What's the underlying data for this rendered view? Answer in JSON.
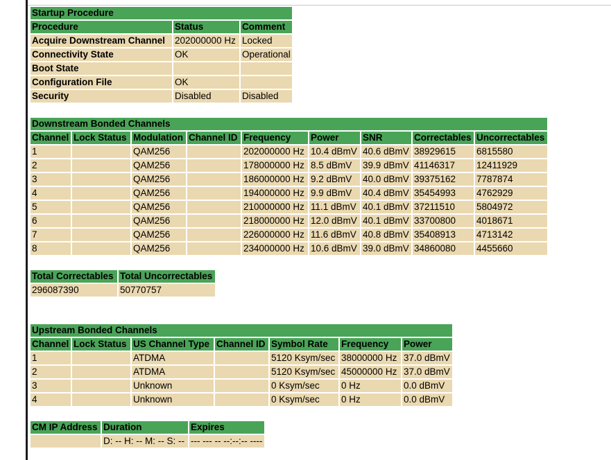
{
  "startup": {
    "title": "Startup Procedure",
    "headers": [
      "Procedure",
      "Status",
      "Comment"
    ],
    "rows": [
      [
        "Acquire Downstream Channel",
        "202000000 Hz",
        "Locked"
      ],
      [
        "Connectivity State",
        "OK",
        "Operational"
      ],
      [
        "Boot State",
        "",
        ""
      ],
      [
        "Configuration File",
        "OK",
        ""
      ],
      [
        "Security",
        "Disabled",
        "Disabled"
      ]
    ]
  },
  "downstream": {
    "title": "Downstream Bonded Channels",
    "headers": [
      "Channel",
      "Lock Status",
      "Modulation",
      "Channel ID",
      "Frequency",
      "Power",
      "SNR",
      "Correctables",
      "Uncorrectables"
    ],
    "rows": [
      [
        "1",
        "",
        "QAM256",
        "",
        "202000000 Hz",
        "10.4 dBmV",
        "40.6 dBmV",
        "38929615",
        "6815580"
      ],
      [
        "2",
        "",
        "QAM256",
        "",
        "178000000 Hz",
        "8.5 dBmV",
        "39.9 dBmV",
        "41146317",
        "12411929"
      ],
      [
        "3",
        "",
        "QAM256",
        "",
        "186000000 Hz",
        "9.2 dBmV",
        "40.0 dBmV",
        "39375162",
        "7787874"
      ],
      [
        "4",
        "",
        "QAM256",
        "",
        "194000000 Hz",
        "9.9 dBmV",
        "40.4 dBmV",
        "35454993",
        "4762929"
      ],
      [
        "5",
        "",
        "QAM256",
        "",
        "210000000 Hz",
        "11.1 dBmV",
        "40.1 dBmV",
        "37211510",
        "5804972"
      ],
      [
        "6",
        "",
        "QAM256",
        "",
        "218000000 Hz",
        "12.0 dBmV",
        "40.1 dBmV",
        "33700800",
        "4018671"
      ],
      [
        "7",
        "",
        "QAM256",
        "",
        "226000000 Hz",
        "11.6 dBmV",
        "40.8 dBmV",
        "35408913",
        "4713142"
      ],
      [
        "8",
        "",
        "QAM256",
        "",
        "234000000 Hz",
        "10.6 dBmV",
        "39.0 dBmV",
        "34860080",
        "4455660"
      ]
    ]
  },
  "totals": {
    "headers": [
      "Total Correctables",
      "Total Uncorrectables"
    ],
    "values": [
      "296087390",
      "50770757"
    ]
  },
  "upstream": {
    "title": "Upstream Bonded Channels",
    "headers": [
      "Channel",
      "Lock Status",
      "US Channel Type",
      "Channel ID",
      "Symbol Rate",
      "Frequency",
      "Power"
    ],
    "rows": [
      [
        "1",
        "",
        "ATDMA",
        "",
        "5120 Ksym/sec",
        "38000000 Hz",
        "37.0 dBmV"
      ],
      [
        "2",
        "",
        "ATDMA",
        "",
        "5120 Ksym/sec",
        "45000000 Hz",
        "37.0 dBmV"
      ],
      [
        "3",
        "",
        "Unknown",
        "",
        "0 Ksym/sec",
        "0 Hz",
        "0.0 dBmV"
      ],
      [
        "4",
        "",
        "Unknown",
        "",
        "0 Ksym/sec",
        "0 Hz",
        "0.0 dBmV"
      ]
    ]
  },
  "cmip": {
    "headers": [
      "CM IP Address",
      "Duration",
      "Expires"
    ],
    "values": [
      "",
      "D: -- H: -- M: -- S: --",
      "--- --- -- --:--:-- ----"
    ]
  },
  "colors": {
    "header_green": "#4aa458",
    "cell_tan": "#ead8b0"
  }
}
